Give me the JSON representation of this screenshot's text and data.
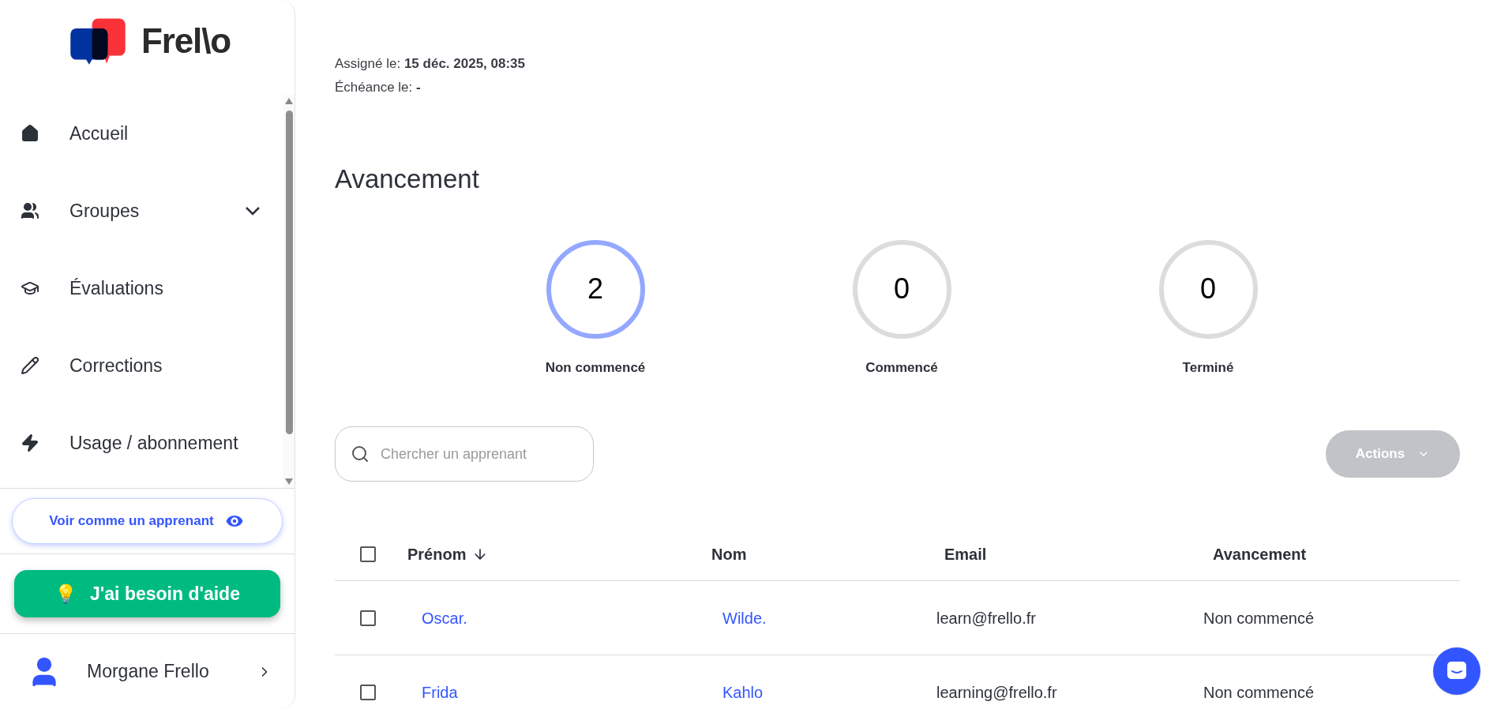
{
  "sidebar": {
    "logo": {
      "text": "Frel\\o"
    },
    "items": [
      {
        "label": "Accueil",
        "kind": "home"
      },
      {
        "label": "Groupes",
        "kind": "users",
        "expanded": false
      },
      {
        "label": "Évaluations",
        "kind": "cap"
      },
      {
        "label": "Corrections",
        "kind": "pencil"
      },
      {
        "label": "Usage / abonnement",
        "kind": "bolt"
      }
    ],
    "learner_view_button": "Voir comme un apprenant",
    "help_button": {
      "emoji": "💡",
      "label": "J'ai besoin d'aide"
    },
    "profile": {
      "name": "Morgane Frello"
    }
  },
  "details": [
    {
      "label": "Assigné le:",
      "value": "15 déc. 2025, 08:35"
    },
    {
      "label": "Échéance le:",
      "value": "-"
    }
  ],
  "progress": {
    "title": "Avancement",
    "stats": [
      {
        "count": "2",
        "label": "Non commencé",
        "highlighted": true
      },
      {
        "count": "0",
        "label": "Commencé",
        "highlighted": false
      },
      {
        "count": "0",
        "label": "Terminé",
        "highlighted": false
      }
    ]
  },
  "search": {
    "placeholder": "Chercher un apprenant"
  },
  "actions_button": {
    "label": "Actions",
    "disabled": true
  },
  "table": {
    "select_all_checked": false,
    "columns": [
      {
        "label": "Prénom",
        "sorted": true
      },
      {
        "label": "Nom",
        "sorted": false
      },
      {
        "label": "Email",
        "sorted": false
      },
      {
        "label": "Avancement",
        "sorted": false
      }
    ],
    "rows": [
      {
        "checked": false,
        "first_name": "Oscar.",
        "last_name": "Wilde.",
        "email": "learn@frello.fr",
        "status": "Non commencé"
      },
      {
        "checked": false,
        "first_name": "Frida",
        "last_name": "Kahlo",
        "email": "learning@frello.fr",
        "status": "Non commencé"
      }
    ]
  }
}
